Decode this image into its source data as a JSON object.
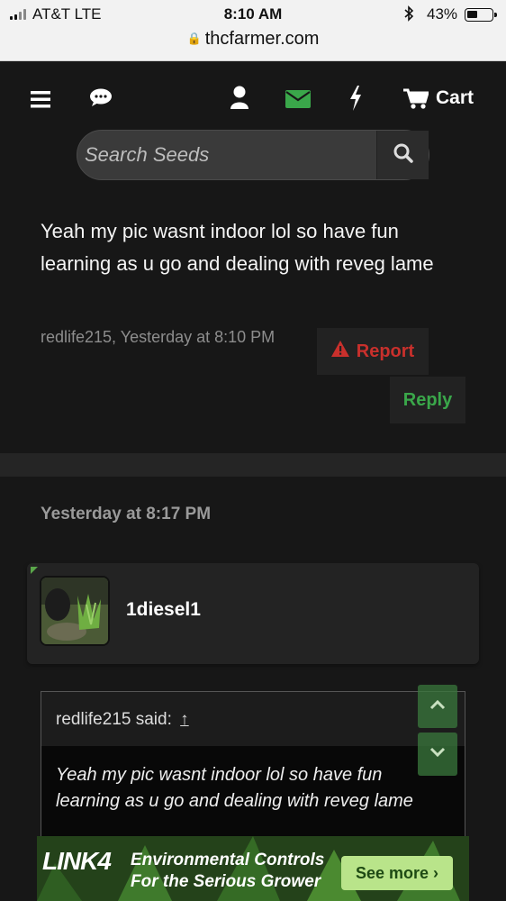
{
  "status_bar": {
    "carrier": "AT&T  LTE",
    "time": "8:10 AM",
    "bluetooth": "bluetooth-icon",
    "battery_percent": "43%",
    "battery_level": 0.43
  },
  "url_bar": {
    "domain": "thcfarmer.com",
    "lock_icon": "lock-icon"
  },
  "nav": {
    "items": [
      "menu-icon",
      "chat-icon",
      "user-icon",
      "envelope-icon",
      "lightning-icon",
      "cart-icon"
    ],
    "cart_label": "Cart",
    "accent": "#3aa74a"
  },
  "search": {
    "placeholder": "Search Seeds"
  },
  "post1": {
    "text": "Yeah my pic wasnt indoor lol so have fun learning as u go and dealing with reveg lame",
    "meta": "redlife215, Yesterday at 8:10 PM",
    "report_label": "Report",
    "reply_label": "Reply"
  },
  "post2": {
    "date": "Yesterday at 8:17 PM",
    "username": "1diesel1",
    "quote": {
      "author_line": "redlife215 said:",
      "jump_icon": "↑",
      "text": "Yeah my pic wasnt indoor lol so have fun learning as u go and dealing with reveg lame"
    }
  },
  "ad": {
    "logo": "LINK4",
    "line1": "Environmental Controls",
    "line2": "For the Serious Grower",
    "cta": "See more ›"
  },
  "colors": {
    "report": "#c9302c",
    "reply": "#3aa74a",
    "background": "#171717"
  }
}
